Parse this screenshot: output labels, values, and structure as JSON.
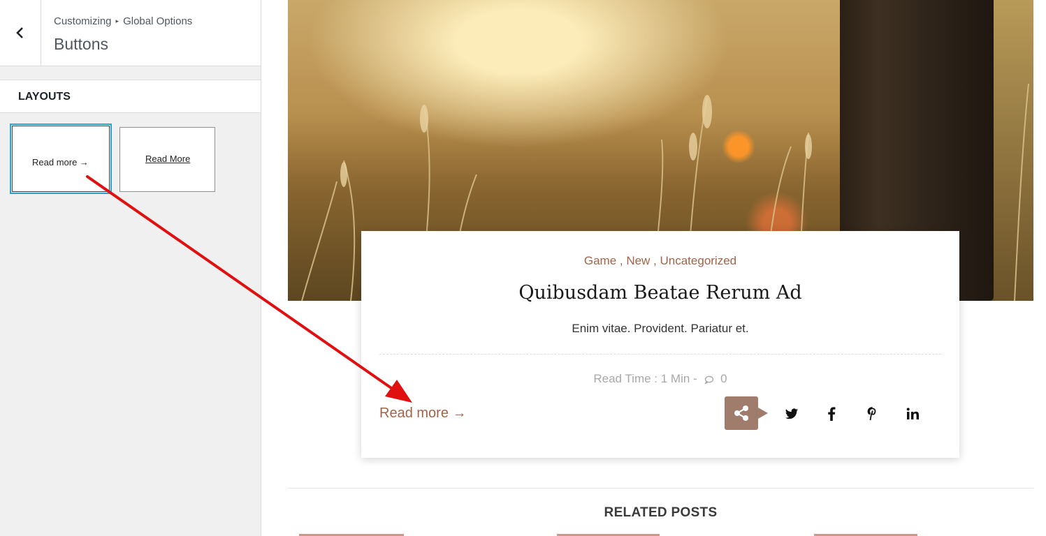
{
  "sidebar": {
    "breadcrumb": {
      "part1": "Customizing",
      "separator": "▸",
      "part2": "Global Options"
    },
    "title": "Buttons",
    "section_label": "LAYOUTS",
    "layouts": [
      {
        "label": "Read more →",
        "selected": true
      },
      {
        "label": "Read More",
        "selected": false
      }
    ]
  },
  "post": {
    "categories": "Game , New , Uncategorized",
    "title": "Quibusdam Beatae Rerum Ad",
    "excerpt": "Enim vitae. Provident. Pariatur et.",
    "meta": {
      "read_time": "Read Time :  1 Min  -",
      "comments": "0"
    },
    "read_more": "Read more  →",
    "social_icons": [
      "share-icon",
      "twitter-icon",
      "facebook-icon",
      "pinterest-icon",
      "linkedin-icon"
    ]
  },
  "related": {
    "title": "RELATED POSTS"
  },
  "colors": {
    "accent": "#a0644a",
    "share_bg": "#a07c6c",
    "selected_outline": "#2ea2cc",
    "arrow": "#e01010"
  }
}
